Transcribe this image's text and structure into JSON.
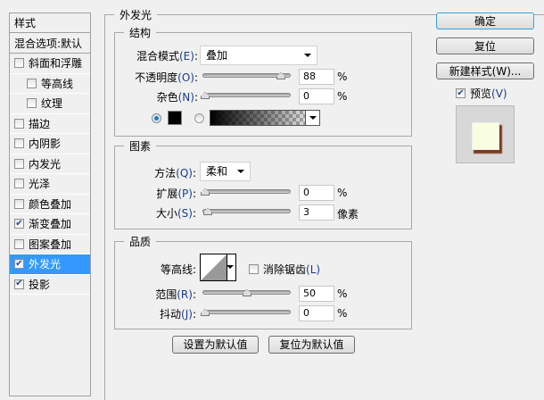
{
  "sidebar": {
    "header": "样式",
    "blend": "混合选项:默认",
    "items": [
      {
        "label": "斜面和浮雕",
        "checked": false
      },
      {
        "label": "等高线",
        "checked": false,
        "sub": true
      },
      {
        "label": "纹理",
        "checked": false,
        "sub": true
      },
      {
        "label": "描边",
        "checked": false
      },
      {
        "label": "内阴影",
        "checked": false
      },
      {
        "label": "内发光",
        "checked": false
      },
      {
        "label": "光泽",
        "checked": false
      },
      {
        "label": "颜色叠加",
        "checked": false
      },
      {
        "label": "渐变叠加",
        "checked": true
      },
      {
        "label": "图案叠加",
        "checked": false
      },
      {
        "label": "外发光",
        "checked": true,
        "selected": true
      },
      {
        "label": "投影",
        "checked": true
      }
    ]
  },
  "main": {
    "title": "外发光",
    "structure": {
      "title": "结构",
      "blend_mode_label": "混合模式",
      "blend_mode_key": "(E)",
      "blend_mode": "叠加",
      "opacity_label": "不透明度",
      "opacity_key": "(O)",
      "opacity": "88",
      "noise_label": "杂色",
      "noise_key": "(N)",
      "noise": "0",
      "pct": "%",
      "color": "#000000"
    },
    "elements": {
      "title": "图素",
      "method_label": "方法",
      "method_key": "(Q)",
      "method": "柔和",
      "spread_label": "扩展",
      "spread_key": "(P)",
      "spread": "0",
      "size_label": "大小",
      "size_key": "(S)",
      "size": "3",
      "size_unit": "像素",
      "pct": "%"
    },
    "quality": {
      "title": "品质",
      "contour_label": "等高线:",
      "antialias_label": "消除锯齿",
      "antialias_key": "(L)",
      "range_label": "范围",
      "range_key": "(R)",
      "range": "50",
      "jitter_label": "抖动",
      "jitter_key": "(J)",
      "jitter": "0",
      "pct": "%"
    },
    "set_default": "设置为默认值",
    "reset_default": "复位为默认值"
  },
  "right": {
    "ok": "确定",
    "reset": "复位",
    "new_style": "新建样式(W)...",
    "preview_label": "预览",
    "preview_key": "(V)",
    "preview_checked": true
  }
}
